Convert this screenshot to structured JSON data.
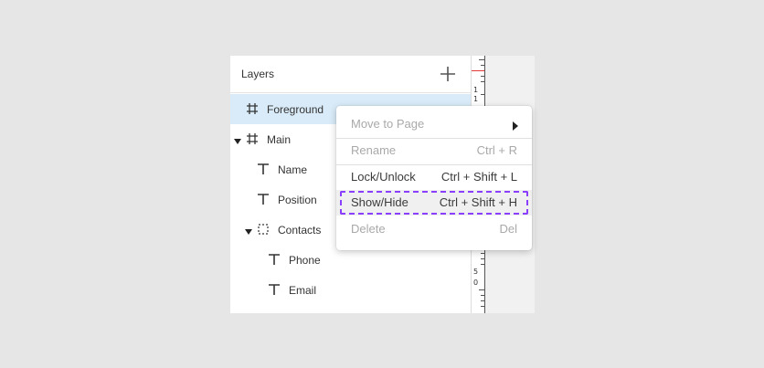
{
  "layers_panel": {
    "title": "Layers",
    "add_icon": "plus-icon",
    "items": [
      {
        "label": "Foreground",
        "icon": "frame-icon",
        "selected": true
      },
      {
        "label": "Main",
        "icon": "frame-icon",
        "expanded": true
      },
      {
        "label": "Name",
        "icon": "text-icon"
      },
      {
        "label": "Position",
        "icon": "text-icon"
      },
      {
        "label": "Contacts",
        "icon": "group-icon",
        "expanded": true
      },
      {
        "label": "Phone",
        "icon": "text-icon"
      },
      {
        "label": "Email",
        "icon": "text-icon"
      }
    ]
  },
  "ruler": {
    "labels": [
      "1",
      "1",
      "5",
      "0"
    ],
    "marker_color": "#e43a3a"
  },
  "context_menu": {
    "items": [
      {
        "label": "Move to Page",
        "shortcut": "",
        "disabled": true,
        "submenu": true
      },
      {
        "label": "Rename",
        "shortcut": "Ctrl + R",
        "disabled": true
      },
      {
        "label": "Lock/Unlock",
        "shortcut": "Ctrl + Shift + L",
        "disabled": false
      },
      {
        "label": "Show/Hide",
        "shortcut": "Ctrl + Shift + H",
        "disabled": false,
        "hovered": true
      },
      {
        "label": "Delete",
        "shortcut": "Del",
        "disabled": true
      }
    ]
  },
  "colors": {
    "selected_row": "#d9ebf8",
    "hover_outline": "#8a3ffc",
    "background": "#e6e6e6"
  }
}
